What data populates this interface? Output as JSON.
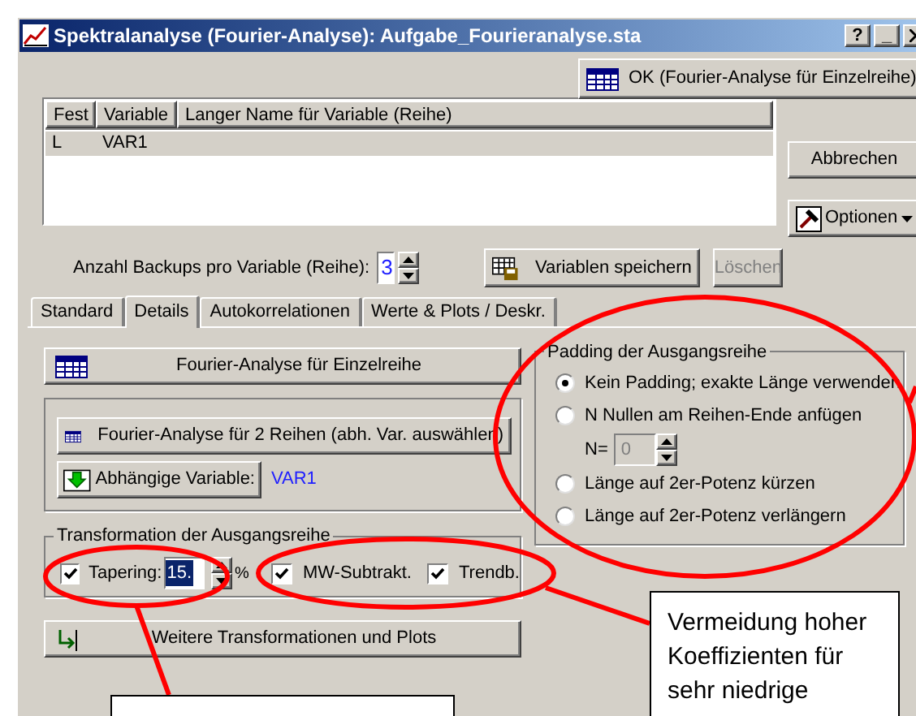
{
  "window": {
    "title": "Spektralanalyse (Fourier-Analyse): Aufgabe_Fourieranalyse.sta",
    "controls": [
      "?",
      "_"
    ]
  },
  "ok_button": "OK (Fourier-Analyse für Einzelreihe)",
  "variables_table": {
    "columns": [
      "Fest",
      "Variable",
      "Langer Name für Variable (Reihe)"
    ],
    "rows": [
      {
        "cells": [
          "L",
          "VAR1",
          ""
        ],
        "selected": true
      }
    ]
  },
  "side_buttons": [
    "Abbrechen",
    "Optionen"
  ],
  "backups": {
    "label": "Anzahl Backups pro Variable (Reihe):",
    "value": "3"
  },
  "save_button": {
    "label": "Variablen speichern",
    "disabled": false
  },
  "delete_button": {
    "label": "Löschen",
    "disabled": true
  },
  "tabs": [
    {
      "label": "Standard",
      "selected": false
    },
    {
      "label": "Details",
      "selected": true
    },
    {
      "label": "Autokorrelationen",
      "selected": false
    },
    {
      "label": "Werte & Plots / Deskr.",
      "selected": false
    }
  ],
  "single_series_button": "Fourier-Analyse für Einzelreihe",
  "two_series_button": "Fourier-Analyse für 2 Reihen (abh. Var. auswählen)",
  "dependent": {
    "button": "Abhängige Variable:",
    "value": "VAR1"
  },
  "transformation": {
    "title": "Transformation der Ausgangsreihe",
    "tapering": {
      "label": "Tapering:",
      "checked": true,
      "value": "15.",
      "unit": "%"
    },
    "options": [
      {
        "label": "MW-Subtrakt.",
        "checked": true
      },
      {
        "label": "Trendb.",
        "checked": true
      }
    ]
  },
  "more_button": "Weitere Transformationen und Plots",
  "padding": {
    "title": "Padding der Ausgangsreihe",
    "options": [
      {
        "label": "Kein Padding; exakte Länge verwenden",
        "selected": true
      },
      {
        "label": "N Nullen am Reihen-Ende anfügen",
        "selected": false
      },
      {
        "label": "Länge auf 2er-Potenz kürzen",
        "selected": false
      },
      {
        "label": "Länge auf 2er-Potenz verlängern",
        "selected": false
      }
    ],
    "n_field": {
      "label": "N=",
      "value": "0",
      "disabled": true
    }
  },
  "callouts": [
    {
      "text": "Vermeidung hoher Koeffizienten für sehr niedrige"
    }
  ]
}
